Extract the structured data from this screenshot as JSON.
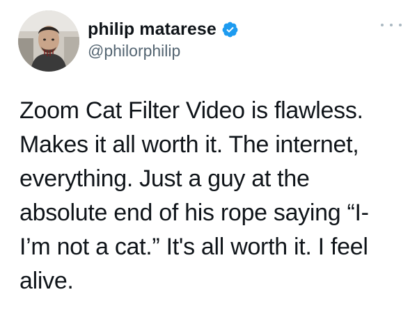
{
  "tweet": {
    "author": {
      "display_name": "philip matarese",
      "handle": "@philorphilip",
      "verified": true,
      "avatar_icon": "user-avatar",
      "verified_icon": "verified-badge-icon"
    },
    "more_icon": "more-options-icon",
    "text_lines": [
      "Zoom Cat Filter Video is flawless.",
      "Makes it all worth it. The internet,",
      "everything. Just a guy at the",
      "absolute end of his rope saying “I-",
      "I’m not a cat.” It's all worth it. I feel",
      "alive."
    ]
  },
  "colors": {
    "text": "#0f1419",
    "secondary": "#536471",
    "verified": "#1d9bf0",
    "more_dots": "#aab8c2"
  }
}
